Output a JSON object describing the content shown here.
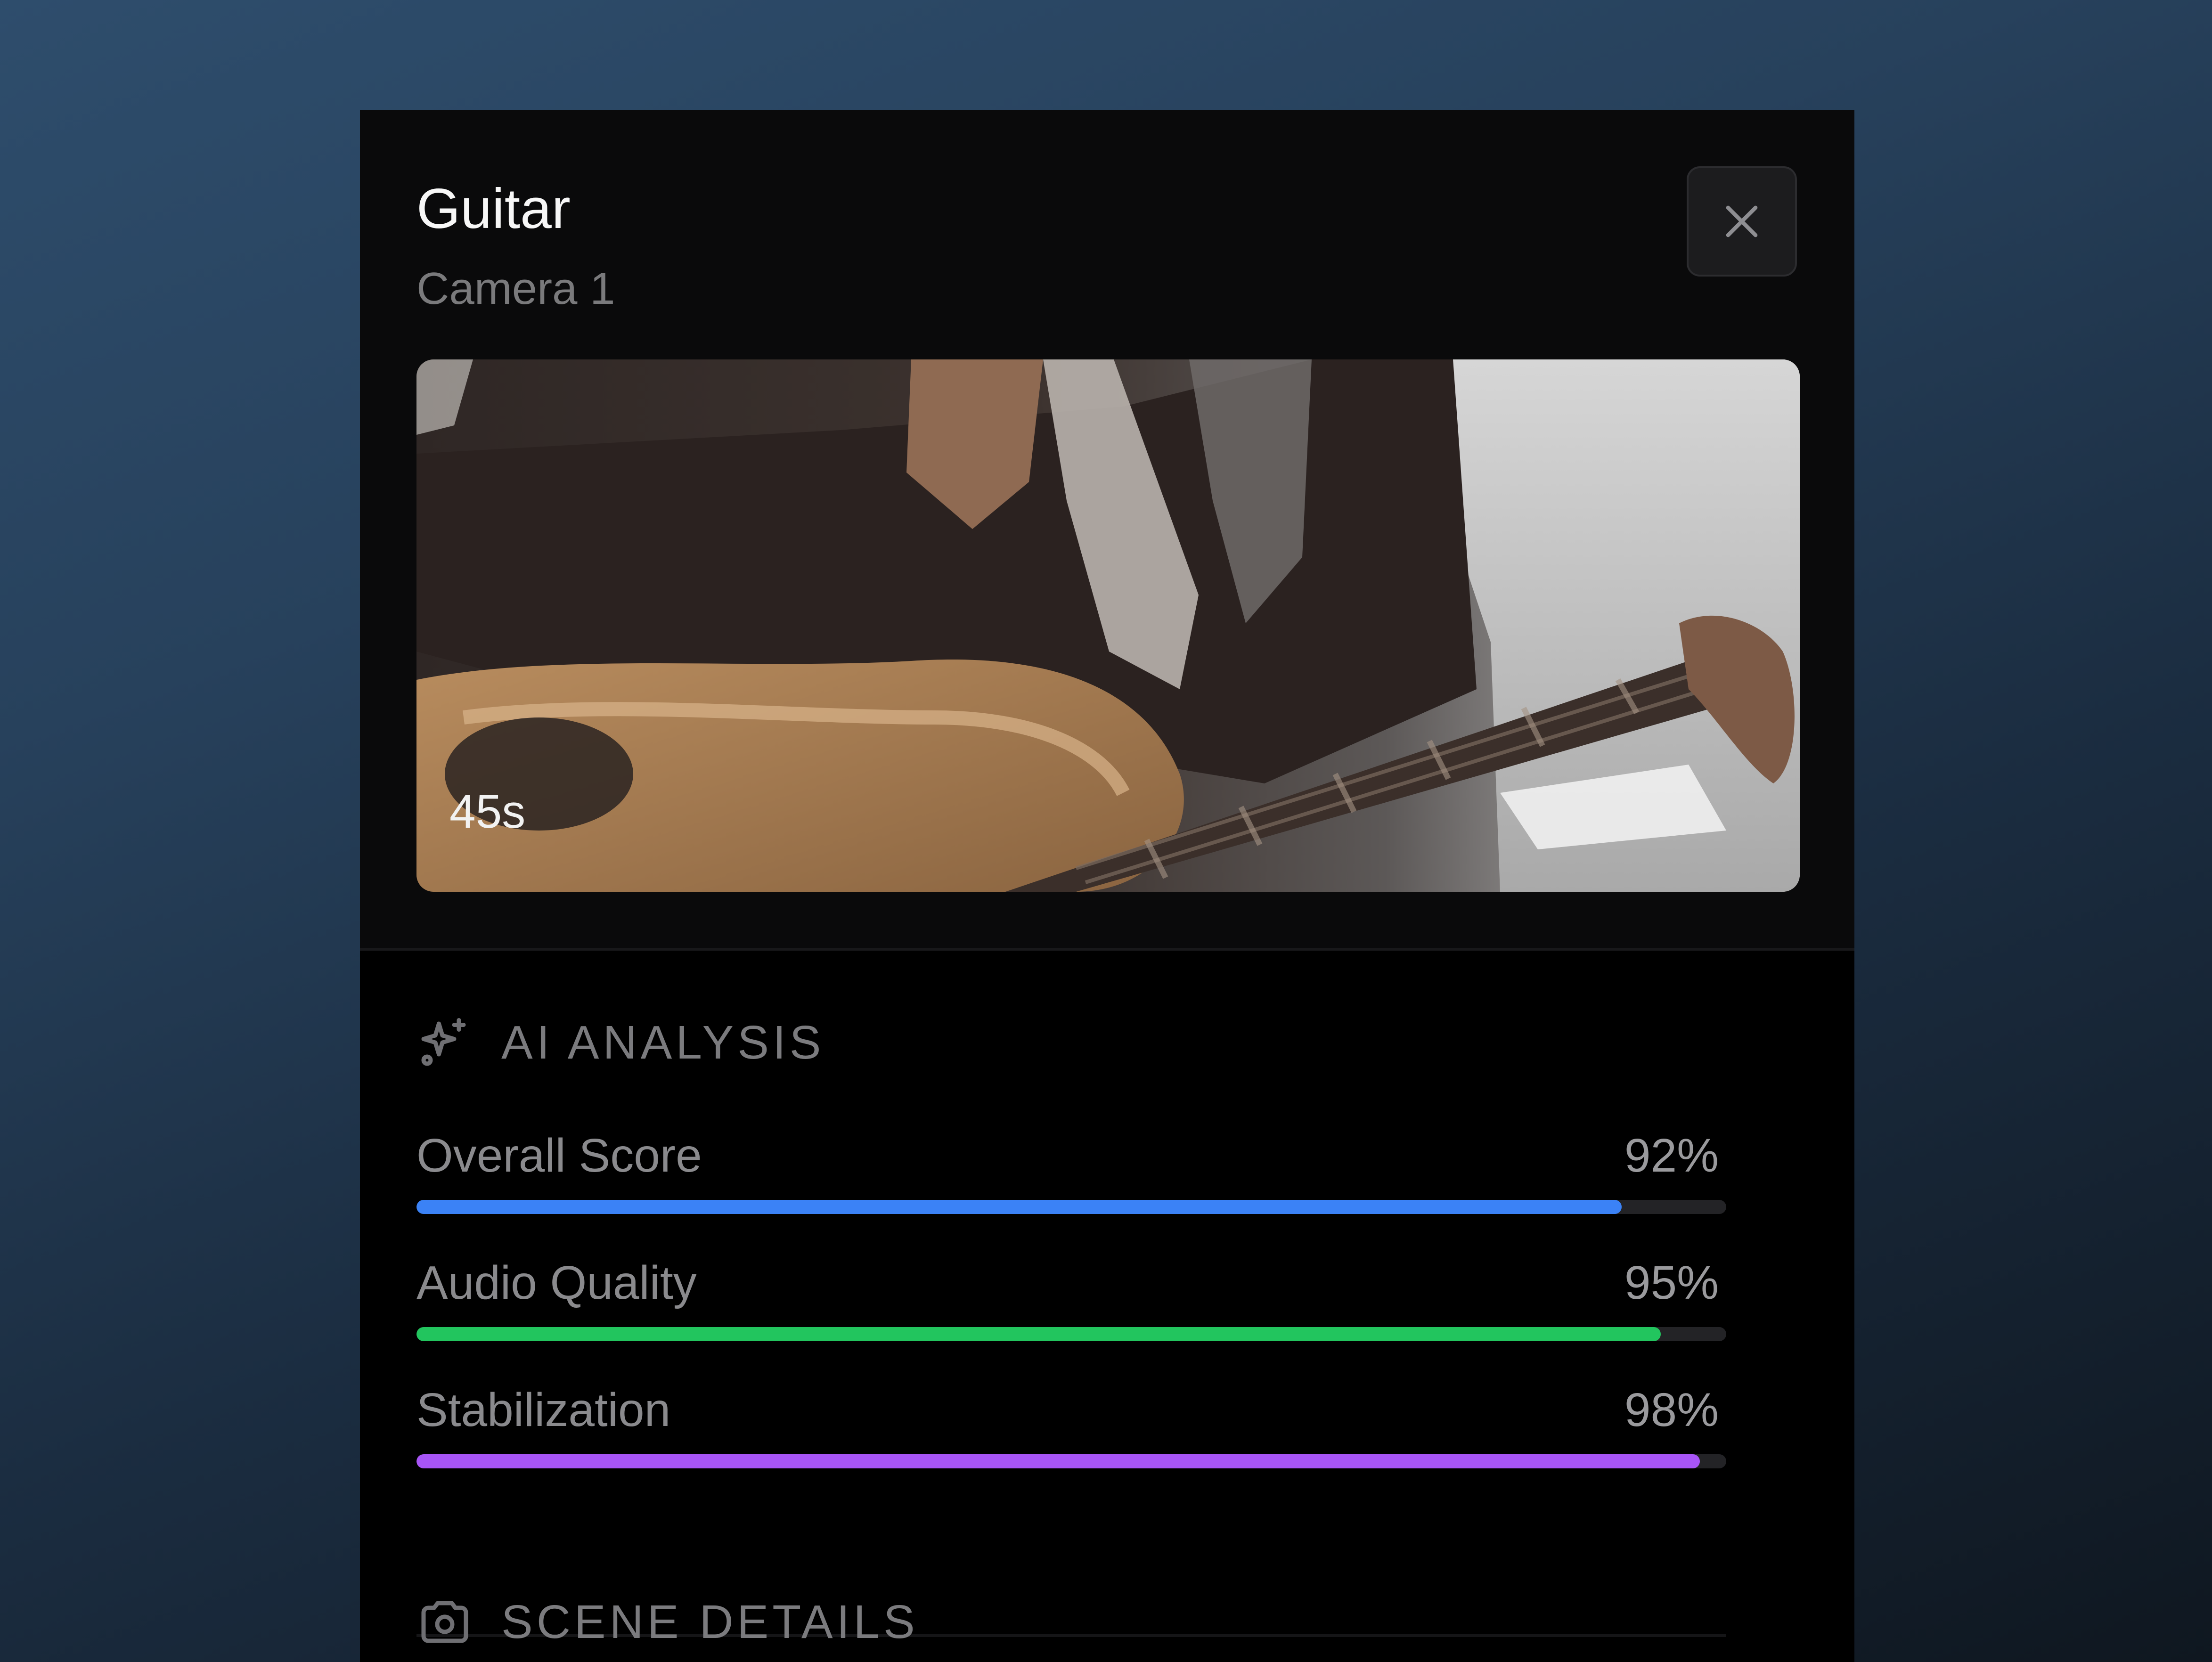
{
  "clip": {
    "title": "Guitar",
    "subtitle": "Camera 1",
    "duration": "45s"
  },
  "close_icon": "close-icon",
  "ai_analysis": {
    "heading": "AI ANALYSIS",
    "icon": "sparkle-icon",
    "metrics": [
      {
        "label": "Overall Score",
        "value": "92%",
        "percent": 92,
        "color": "#3b82f6"
      },
      {
        "label": "Audio Quality",
        "value": "95%",
        "percent": 95,
        "color": "#22c55e"
      },
      {
        "label": "Stabilization",
        "value": "98%",
        "percent": 98,
        "color": "#a855f7"
      }
    ]
  },
  "scene_details": {
    "heading": "SCENE DETAILS",
    "icon": "camera-icon"
  }
}
